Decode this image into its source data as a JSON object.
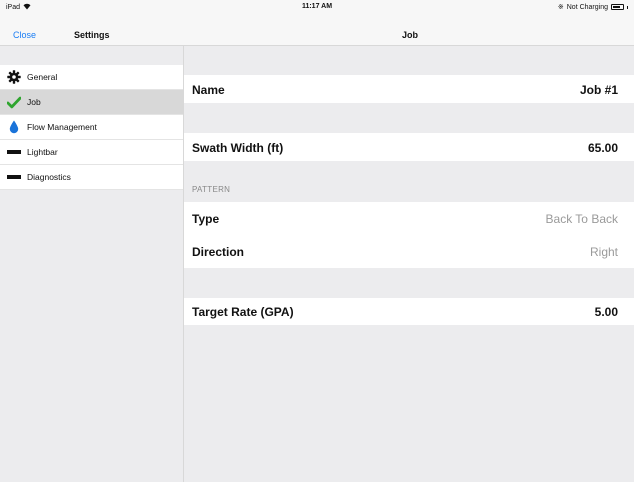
{
  "status_bar": {
    "device": "iPad",
    "wifi_icon": "wifi-icon",
    "time": "11:17 AM",
    "battery_text": "Not Charging",
    "bluetooth_icon": "bluetooth-icon",
    "battery_icon": "battery-icon"
  },
  "nav": {
    "close_label": "Close",
    "sidebar_title": "Settings",
    "detail_title": "Job"
  },
  "sidebar": {
    "items": [
      {
        "label": "General",
        "icon": "gear-icon",
        "selected": false
      },
      {
        "label": "Job",
        "icon": "checkmark-icon",
        "selected": true
      },
      {
        "label": "Flow Management",
        "icon": "water-drop-icon",
        "selected": false
      },
      {
        "label": "Lightbar",
        "icon": "lightbar-icon",
        "selected": false
      },
      {
        "label": "Diagnostics",
        "icon": "diagnostics-icon",
        "selected": false
      }
    ]
  },
  "job": {
    "name_label": "Name",
    "name_value": "Job #1",
    "swath_label": "Swath Width (ft)",
    "swath_value": "65.00",
    "pattern_header": "PATTERN",
    "type_label": "Type",
    "type_value": "Back To Back",
    "direction_label": "Direction",
    "direction_value": "Right",
    "rate_label": "Target Rate (GPA)",
    "rate_value": "5.00"
  },
  "colors": {
    "accent": "#1b7ef4",
    "check": "#2fa52f",
    "drop": "#1a73d9"
  }
}
